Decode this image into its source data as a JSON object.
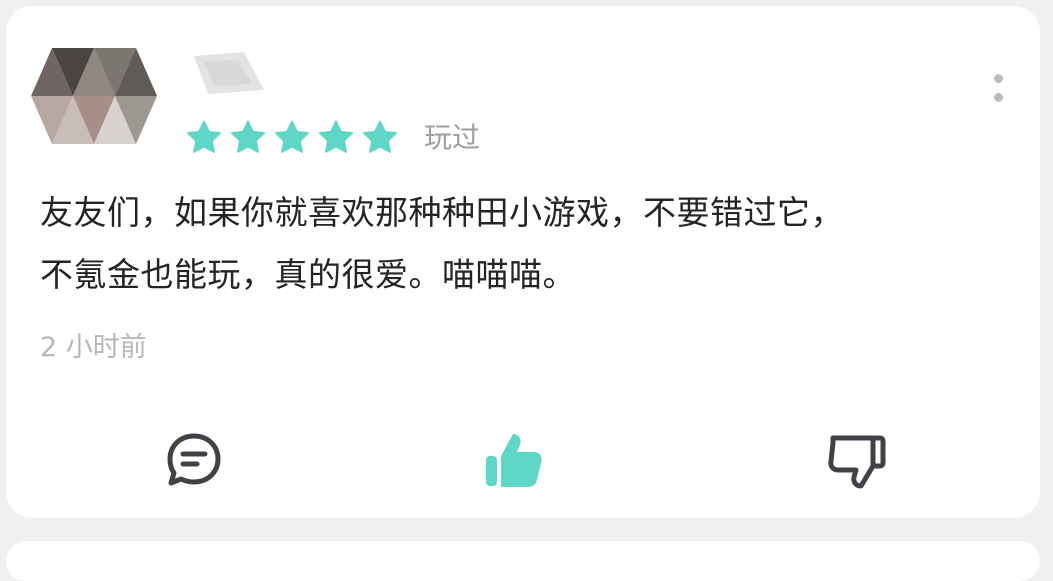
{
  "review": {
    "rating": 5,
    "rating_max": 5,
    "played_tag": "玩过",
    "text_lines": [
      "友友们，如果你就喜欢那种种田小游戏，不要错过它，",
      "不氪金也能玩，真的很爱。喵喵喵。"
    ],
    "time_ago": "2 小时前"
  },
  "colors": {
    "star": "#5fd6c6",
    "like_active": "#5fd6c6",
    "icon_gray": "#3f4347",
    "muted_text": "#b5b8bb"
  },
  "icons": {
    "reply": "chat-bubble-icon",
    "like": "thumbs-up-icon",
    "dislike": "thumbs-down-icon",
    "more": "more-vertical-icon"
  }
}
